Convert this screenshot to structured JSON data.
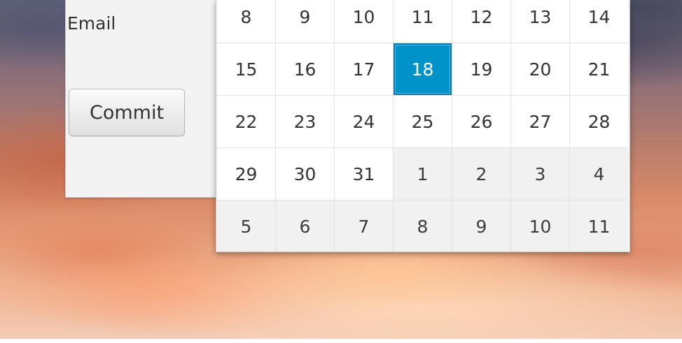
{
  "form": {
    "email_label": "Email",
    "commit_label": "Commit"
  },
  "calendar": {
    "selected_day": "18",
    "selected_color": "#0093c9",
    "weeks": [
      [
        {
          "label": "8",
          "other": false
        },
        {
          "label": "9",
          "other": false
        },
        {
          "label": "10",
          "other": false
        },
        {
          "label": "11",
          "other": false
        },
        {
          "label": "12",
          "other": false
        },
        {
          "label": "13",
          "other": false
        },
        {
          "label": "14",
          "other": false
        }
      ],
      [
        {
          "label": "15",
          "other": false
        },
        {
          "label": "16",
          "other": false
        },
        {
          "label": "17",
          "other": false
        },
        {
          "label": "18",
          "other": false,
          "selected": true
        },
        {
          "label": "19",
          "other": false
        },
        {
          "label": "20",
          "other": false
        },
        {
          "label": "21",
          "other": false
        }
      ],
      [
        {
          "label": "22",
          "other": false
        },
        {
          "label": "23",
          "other": false
        },
        {
          "label": "24",
          "other": false
        },
        {
          "label": "25",
          "other": false
        },
        {
          "label": "26",
          "other": false
        },
        {
          "label": "27",
          "other": false
        },
        {
          "label": "28",
          "other": false
        }
      ],
      [
        {
          "label": "29",
          "other": false
        },
        {
          "label": "30",
          "other": false
        },
        {
          "label": "31",
          "other": false
        },
        {
          "label": "1",
          "other": true
        },
        {
          "label": "2",
          "other": true
        },
        {
          "label": "3",
          "other": true
        },
        {
          "label": "4",
          "other": true
        }
      ],
      [
        {
          "label": "5",
          "other": true
        },
        {
          "label": "6",
          "other": true
        },
        {
          "label": "7",
          "other": true
        },
        {
          "label": "8",
          "other": true
        },
        {
          "label": "9",
          "other": true
        },
        {
          "label": "10",
          "other": true
        },
        {
          "label": "11",
          "other": true
        }
      ]
    ]
  }
}
